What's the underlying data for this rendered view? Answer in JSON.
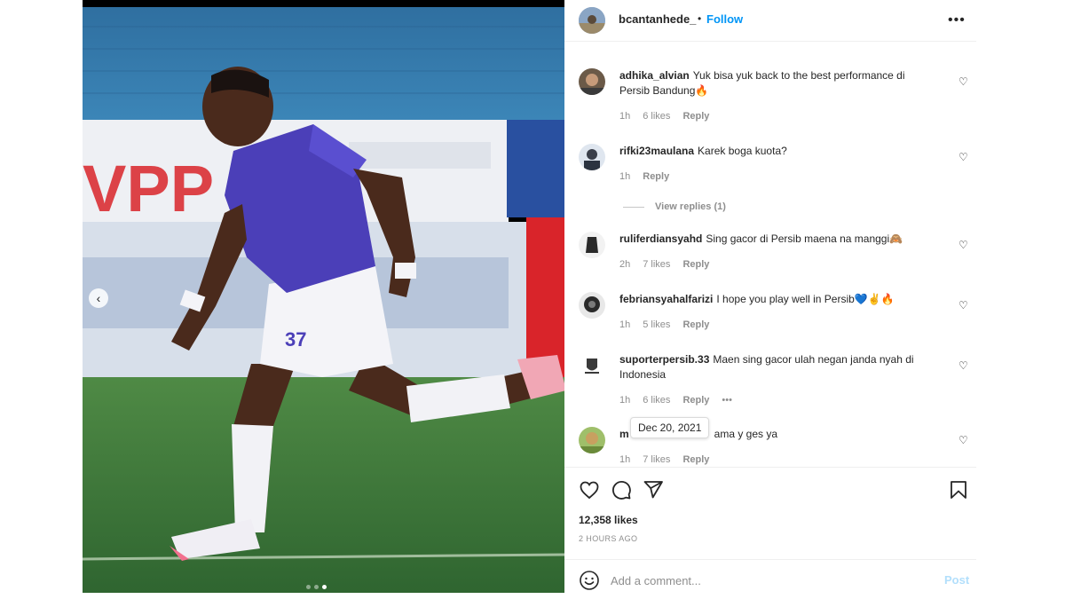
{
  "post": {
    "username": "bcantanhede_",
    "separator": "•",
    "follow_label": "Follow",
    "more_icon": "more-horizontal-icon",
    "likes": "12,358 likes",
    "time_ago": "2 HOURS AGO",
    "photo_description_icon": "photo"
  },
  "carousel": {
    "prev_glyph": "‹",
    "dots": 3,
    "active_dot": 2
  },
  "comments": [
    {
      "username": "adhika_alvian",
      "text": "Yuk bisa yuk back to the best performance di Persib Bandung🔥",
      "time": "1h",
      "likes": "6 likes",
      "reply": "Reply"
    },
    {
      "username": "rifki23maulana",
      "text": "Karek boga kuota?",
      "time": "1h",
      "likes": "",
      "reply": "Reply",
      "view_replies": "View replies (1)"
    },
    {
      "username": "ruliferdiansyahd",
      "text": "Sing gacor di Persib maena na manggi🙈",
      "time": "2h",
      "likes": "7 likes",
      "reply": "Reply"
    },
    {
      "username": "febriansyahalfarizi",
      "text": "I hope you play well in Persib💙✌🔥",
      "time": "1h",
      "likes": "5 likes",
      "reply": "Reply"
    },
    {
      "username": "suporterpersib.33",
      "text": "Maen sing gacor ulah negan janda nyah di Indonesia",
      "time": "1h",
      "likes": "6 likes",
      "reply": "Reply",
      "more": "•••"
    },
    {
      "username": "m",
      "text": "ama y ges ya",
      "time": "1h",
      "likes": "7 likes",
      "reply": "Reply"
    }
  ],
  "tooltip": "Dec 20, 2021",
  "actions": {
    "like_icon": "heart-icon",
    "comment_icon": "comment-icon",
    "share_icon": "send-icon",
    "save_icon": "bookmark-icon"
  },
  "add_comment": {
    "placeholder": "Add a comment...",
    "post_label": "Post",
    "emoji_icon": "smiley-icon"
  },
  "colors": {
    "accent": "#0095f6",
    "post_disabled": "#b2dffc",
    "text": "#262626",
    "muted": "#8e8e8e",
    "jersey": "#4b3fb8"
  }
}
